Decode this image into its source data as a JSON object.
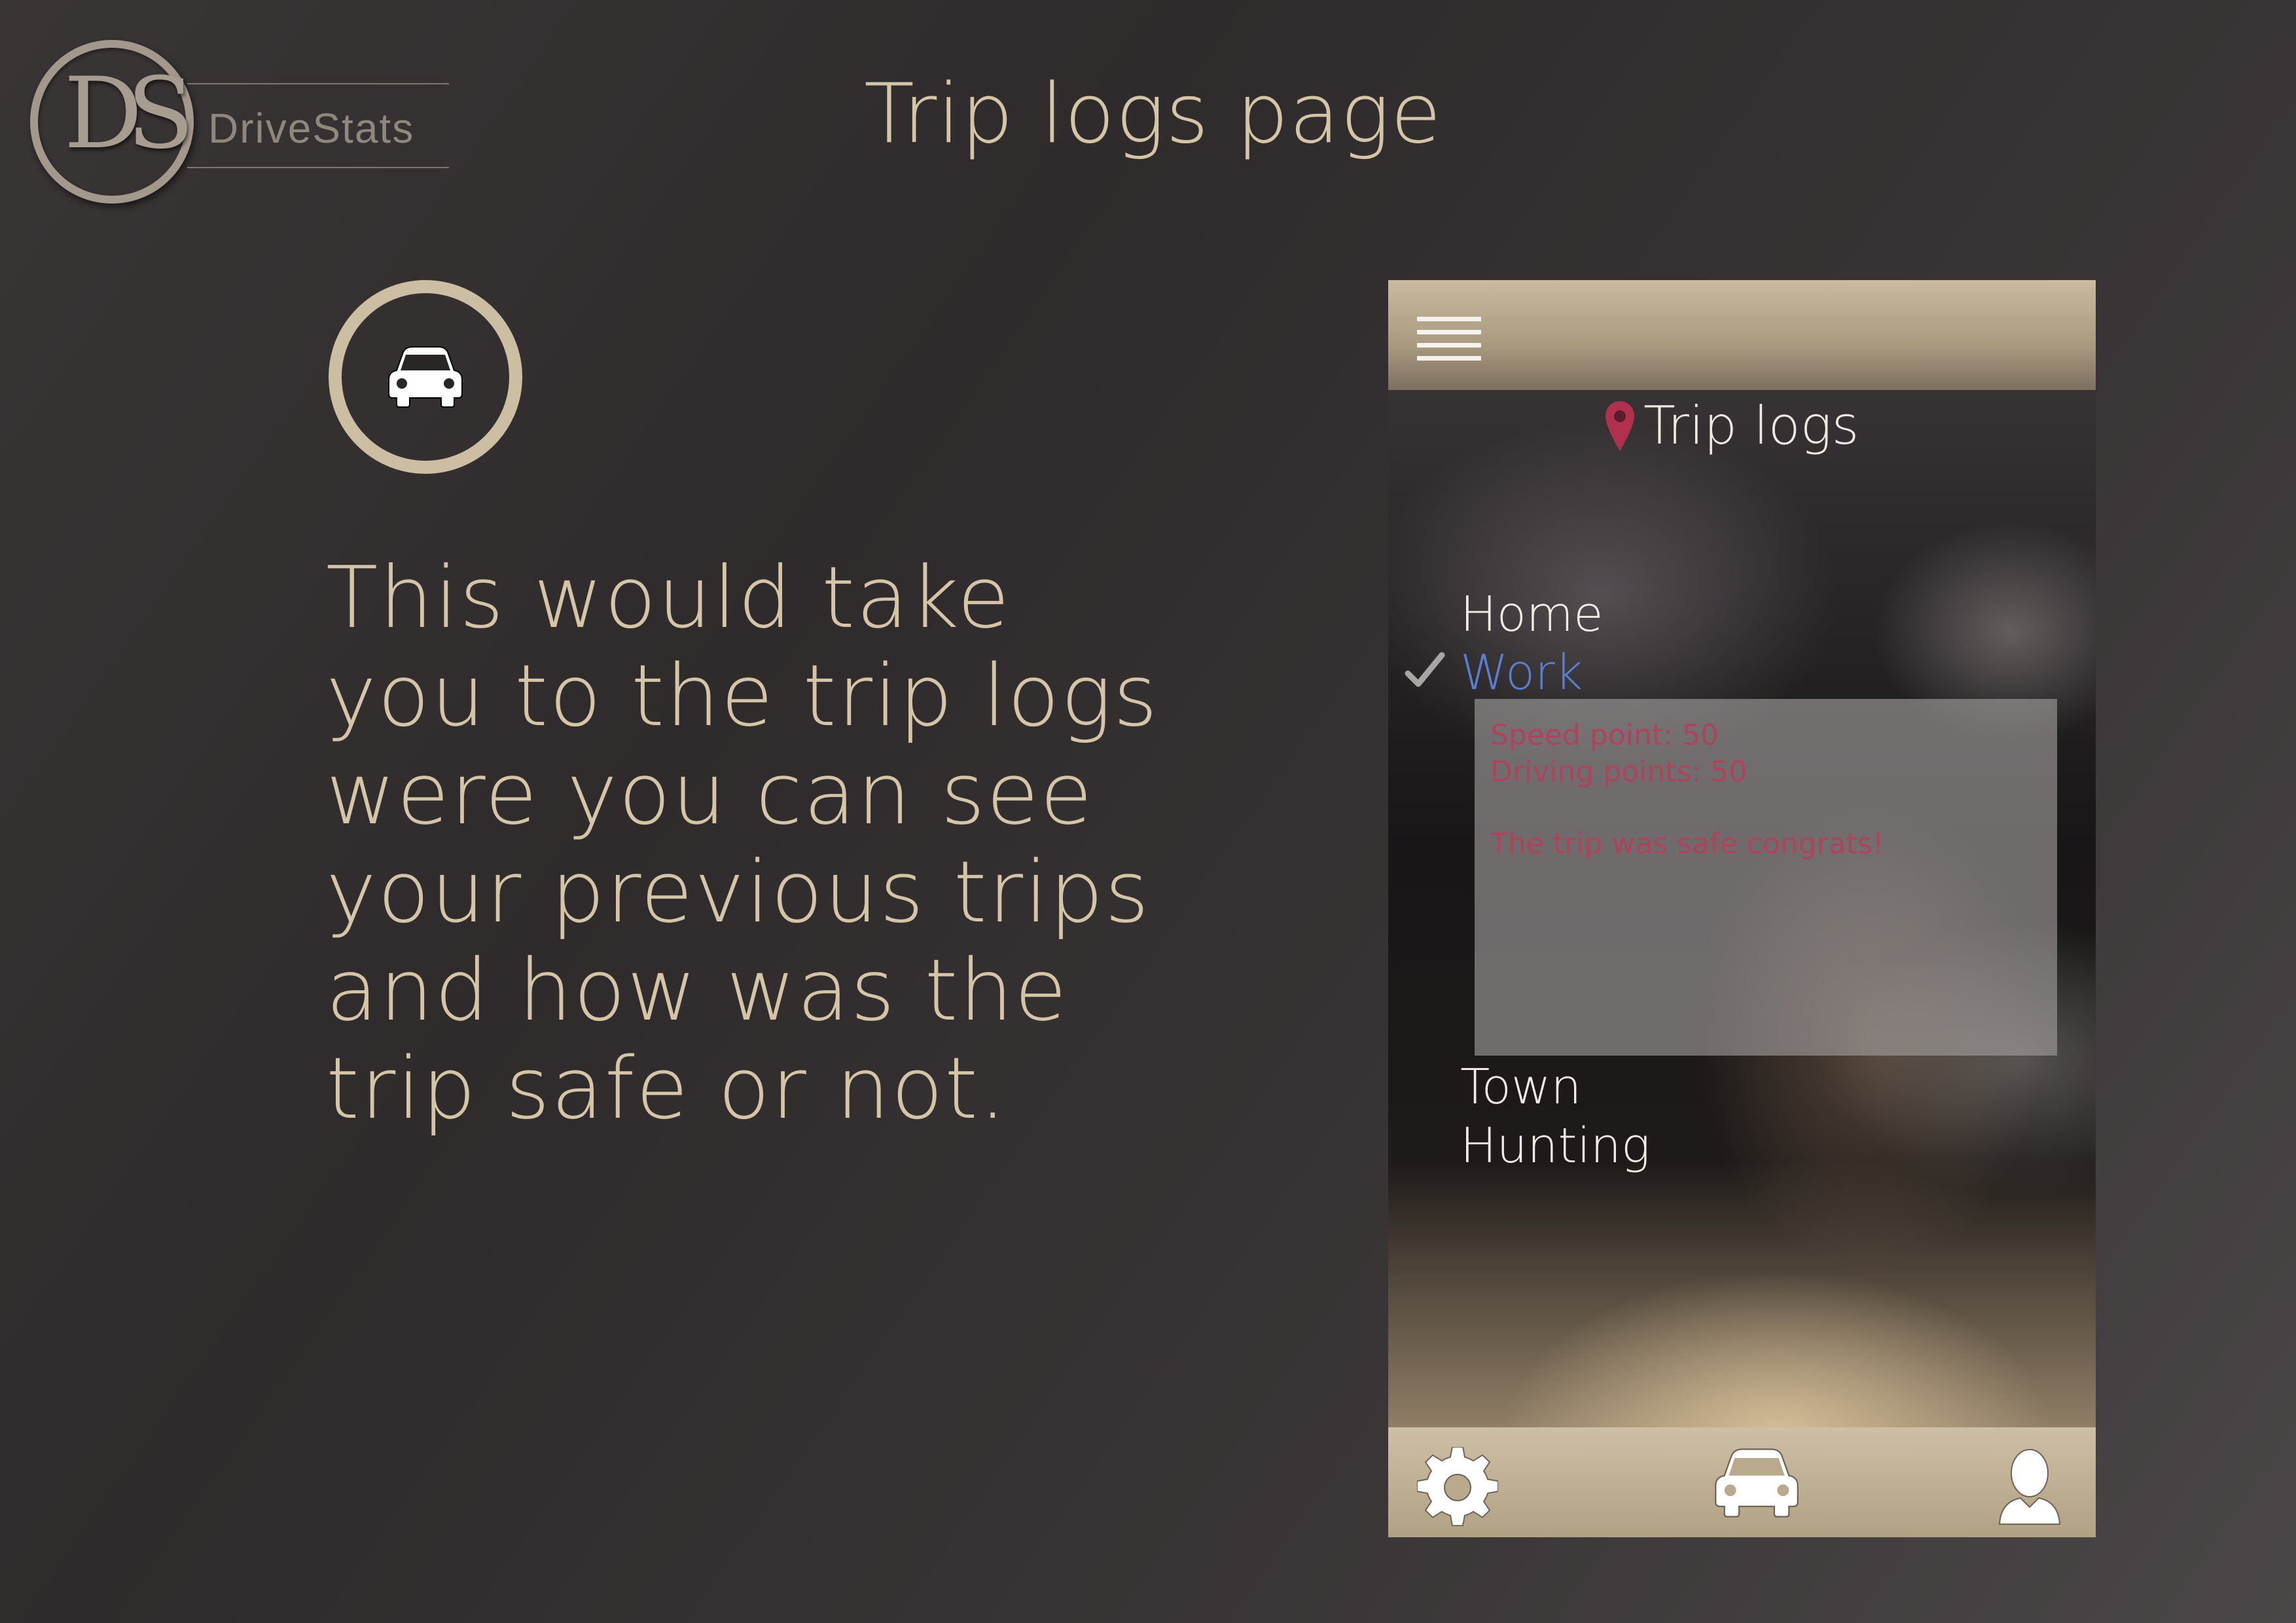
{
  "logo": {
    "mark": "DS",
    "name": "DriveStats"
  },
  "title": "Trip logs page",
  "description_lines": [
    "This would take",
    "you to the trip logs",
    "were you can see",
    "your previous trips",
    "and how was the",
    "trip safe or not."
  ],
  "phone": {
    "heading": "Trip logs",
    "trips": [
      "Home",
      "Work",
      "Town",
      "Hunting"
    ],
    "selected_trip": "Work",
    "details": {
      "speed_points": "Speed point: 50",
      "driving_points": "Driving points: 50",
      "message": "The trip was safe congrats!"
    },
    "bottom_nav": [
      "gear-icon",
      "car-icon",
      "user-icon"
    ]
  },
  "colors": {
    "background": "#332f30",
    "accent_text": "#d4c5a6",
    "selected_trip": "#5b7fd0",
    "detail_text": "#b0425c",
    "pin": "#b0304e"
  }
}
